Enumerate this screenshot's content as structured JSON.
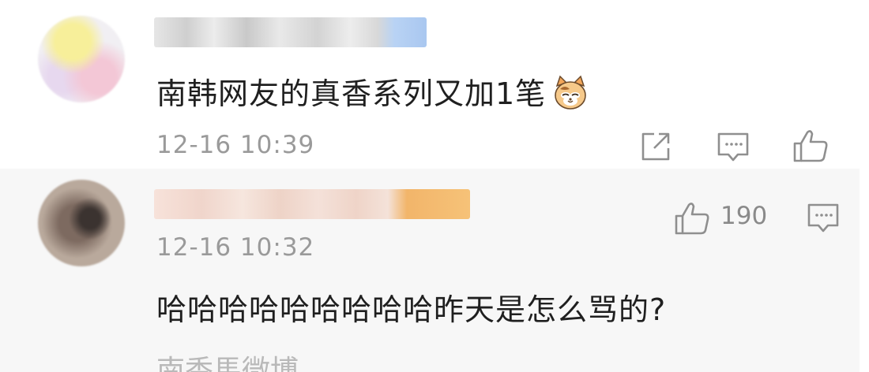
{
  "comments": [
    {
      "content": "南韩网友的真香系列又加1笔",
      "emoji": "cat-face",
      "timestamp": "12-16 10:39",
      "actions": [
        "share-icon",
        "comment-icon",
        "like-icon"
      ]
    },
    {
      "content": "哈哈哈哈哈哈哈哈哈昨天是怎么骂的?",
      "timestamp": "12-16 10:32",
      "likes": "190",
      "actions": [
        "like-icon",
        "comment-icon"
      ]
    }
  ],
  "more_replies_partial": "南香馬微博"
}
